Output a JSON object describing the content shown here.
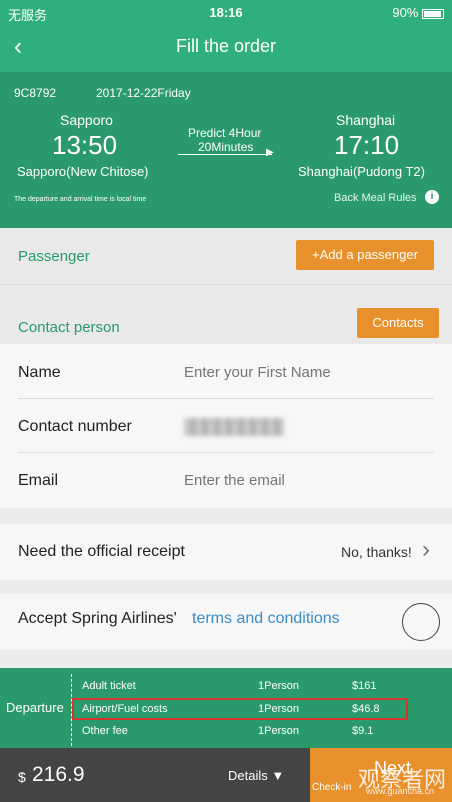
{
  "status": {
    "carrier": "无服务",
    "time": "18:16",
    "battery": "90%"
  },
  "nav": {
    "title": "Fill the order"
  },
  "flight": {
    "number": "9C8792",
    "date": "2017-12-22Friday",
    "from_city": "Sapporo",
    "from_time": "13:50",
    "from_airport": "Sapporo(New Chitose)",
    "duration_line1": "Predict 4Hour",
    "duration_line2": "20Minutes",
    "to_city": "Shanghai",
    "to_time": "17:10",
    "to_airport": "Shanghai(Pudong T2)",
    "note": "The departure and arrival time is local time",
    "meal_rules": "Back Meal Rules"
  },
  "passenger": {
    "title": "Passenger",
    "add_button": "+Add a passenger"
  },
  "contact": {
    "title": "Contact person",
    "contacts_button": "Contacts",
    "name_label": "Name",
    "name_placeholder": "Enter your First Name",
    "phone_label": "Contact number",
    "email_label": "Email",
    "email_placeholder": "Enter the email"
  },
  "receipt": {
    "label": "Need the official receipt",
    "value": "No, thanks!"
  },
  "terms": {
    "prefix": "Accept Spring Airlines'",
    "link": "terms and conditions"
  },
  "fees": {
    "section": "Departure",
    "rows": [
      {
        "name": "Adult ticket",
        "qty": "1Person",
        "price": "$161"
      },
      {
        "name": "Airport/Fuel costs",
        "qty": "1Person",
        "price": "$46.8"
      },
      {
        "name": "Other fee",
        "qty": "1Person",
        "price": "$9.1"
      }
    ]
  },
  "bottom": {
    "currency": "$",
    "total": "216.9",
    "details": "Details",
    "next": "Next",
    "checkin": "Check-in",
    "watermark": "观察者网",
    "watermark_url": "www.guancha.cn"
  },
  "colors": {
    "green": "#2a9a6c",
    "orange": "#e8912c",
    "highlight": "#d9342b"
  }
}
